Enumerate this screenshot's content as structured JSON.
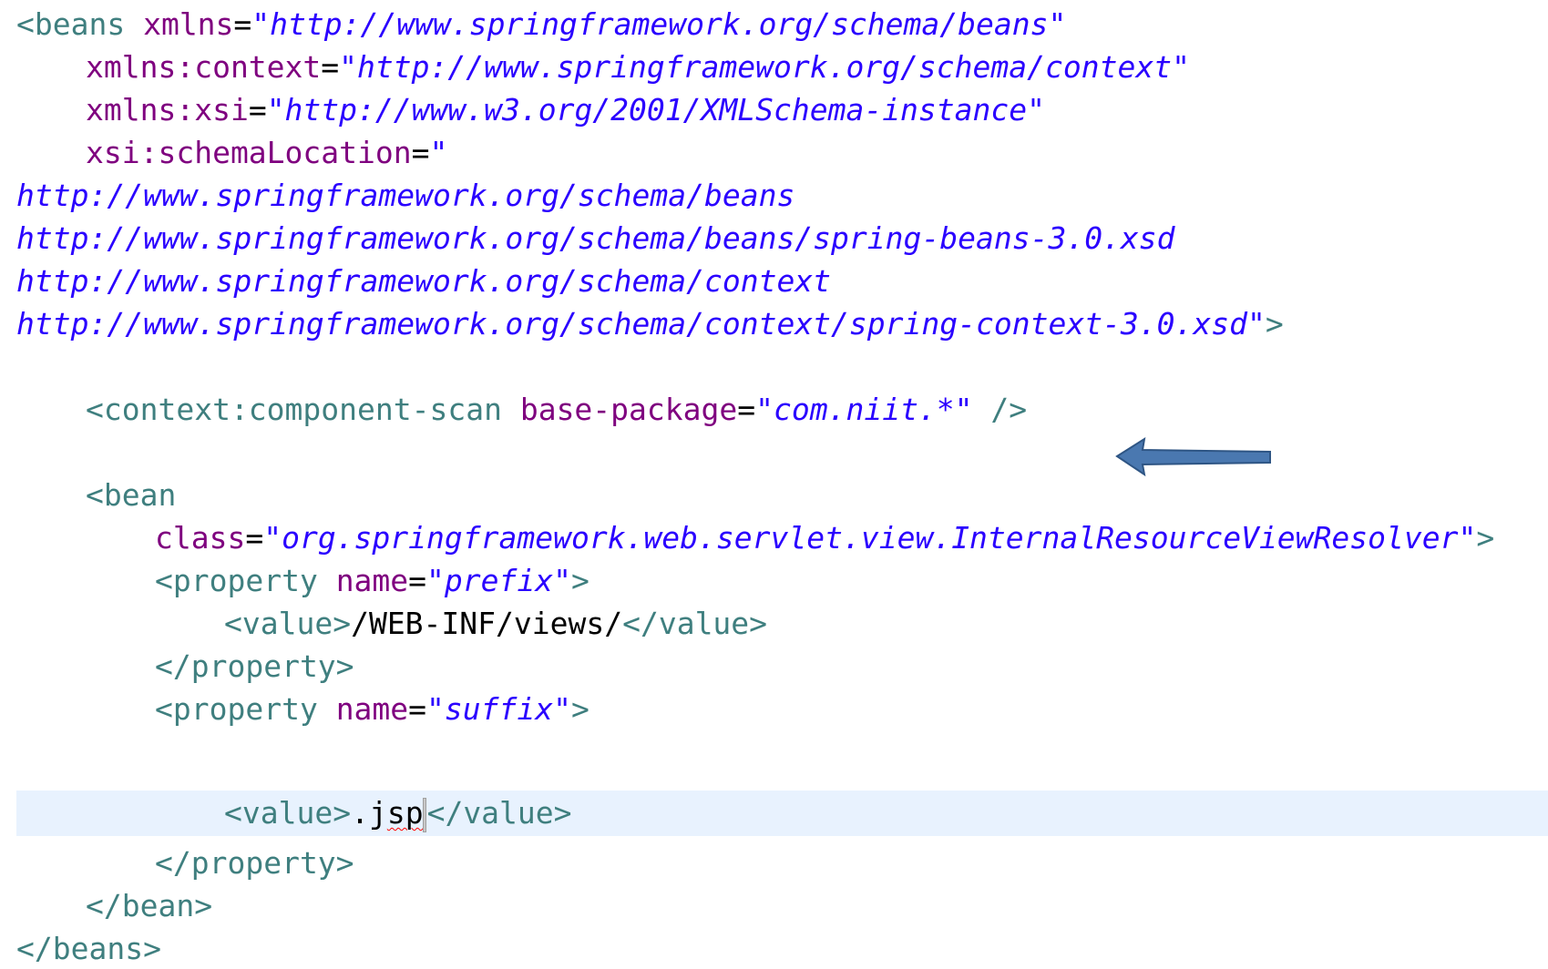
{
  "editor": {
    "lines": {
      "l1": {
        "open": "<beans ",
        "attr": "xmlns",
        "eq": "=",
        "value": "\"http://www.springframework.org/schema/beans\""
      },
      "l2": {
        "attr": "xmlns:context",
        "eq": "=",
        "value": "\"http://www.springframework.org/schema/context\""
      },
      "l3": {
        "attr": "xmlns:xsi",
        "eq": "=",
        "value": "\"http://www.w3.org/2001/XMLSchema-instance\""
      },
      "l4": {
        "attr": "xsi:schemaLocation",
        "eq": "=",
        "value": "\""
      },
      "l5": {
        "value": "http://www.springframework.org/schema/beans"
      },
      "l6": {
        "value": "http://www.springframework.org/schema/beans/spring-beans-3.0.xsd"
      },
      "l7": {
        "value": "http://www.springframework.org/schema/context"
      },
      "l8": {
        "value": "http://www.springframework.org/schema/context/spring-context-3.0.xsd\"",
        "close": ">"
      },
      "l9": {
        "open": "<context:component-scan ",
        "attr": "base-package",
        "eq": "=",
        "value": "\"com.niit.*\"",
        "close": " />"
      },
      "l10": {
        "open": "<bean"
      },
      "l11": {
        "attr": "class",
        "eq": "=",
        "value": "\"org.springframework.web.servlet.view.InternalResourceViewResolver\"",
        "close": ">"
      },
      "l12": {
        "open": "<property ",
        "attr": "name",
        "eq": "=",
        "value": "\"prefix\"",
        "close": ">"
      },
      "l13": {
        "open": "<value>",
        "text": "/WEB-INF/views/",
        "close": "</value>"
      },
      "l14": {
        "close": "</property>"
      },
      "l15": {
        "open": "<property ",
        "attr": "name",
        "eq": "=",
        "value": "\"suffix\"",
        "close": ">"
      },
      "l16": {
        "open": "<value>",
        "text_a": ".j",
        "text_b": "sp",
        "close": "</value>"
      },
      "l17": {
        "close": "</property>"
      },
      "l18": {
        "close": "</bean>"
      },
      "l19": {
        "close": "</beans>"
      }
    },
    "colors": {
      "tag": "#3f7f7f",
      "attribute": "#7f007f",
      "string": "#2a00ff",
      "current_line": "#e8f2fe",
      "arrow_fill": "#4a78b0",
      "arrow_stroke": "#2e5584"
    },
    "annotation": {
      "icon": "arrow-left-icon"
    }
  }
}
